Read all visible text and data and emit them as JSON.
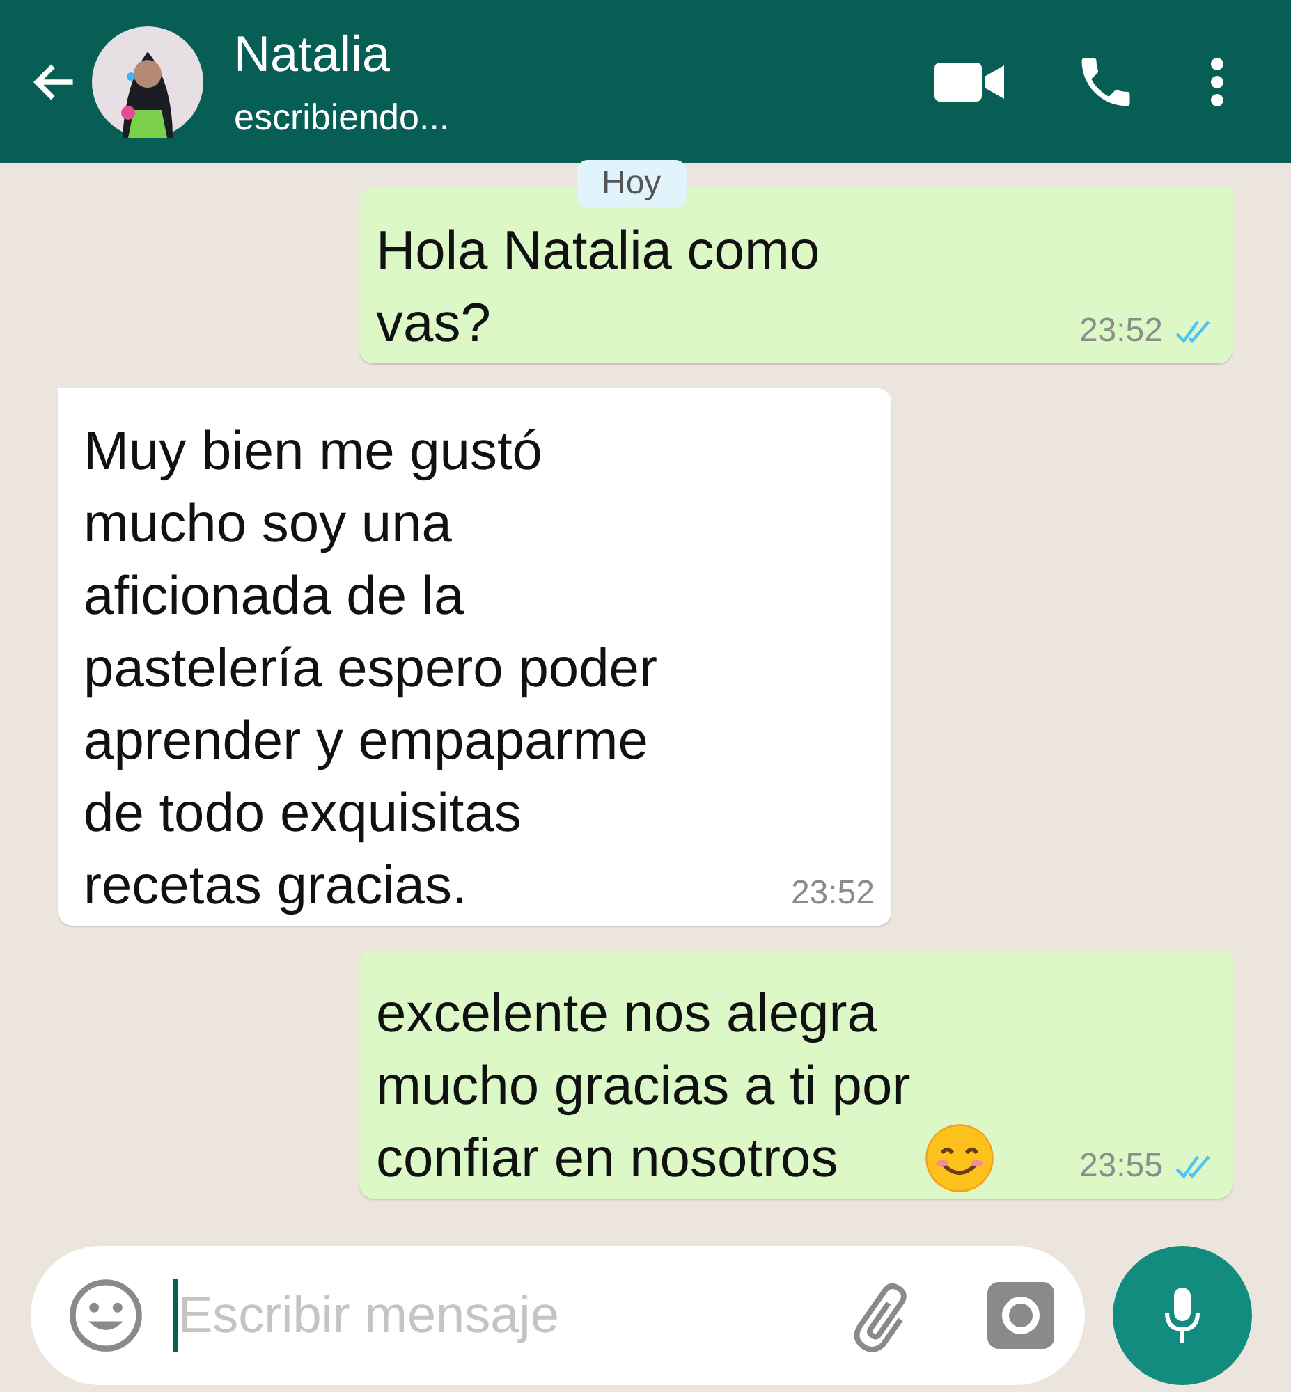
{
  "header": {
    "name": "Natalia",
    "status": "escribiendo..."
  },
  "date_badge": "Hoy",
  "messages": [
    {
      "kind": "out",
      "lines": [
        "Hola Natalia  como",
        "vas?"
      ],
      "time": "23:52",
      "read": true
    },
    {
      "kind": "in",
      "lines": [
        "Muy bien me gustó",
        "mucho soy una",
        "aficionada de la",
        "pastelería espero poder",
        "aprender y empaparme",
        "de todo exquisitas",
        "recetas gracias."
      ],
      "time": "23:52"
    },
    {
      "kind": "out",
      "lines": [
        "excelente nos alegra",
        "mucho gracias a ti por",
        "confiar en nosotros"
      ],
      "time": "23:55",
      "read": true,
      "emoji": true
    }
  ],
  "composer": {
    "placeholder": "Escribir mensaje"
  }
}
